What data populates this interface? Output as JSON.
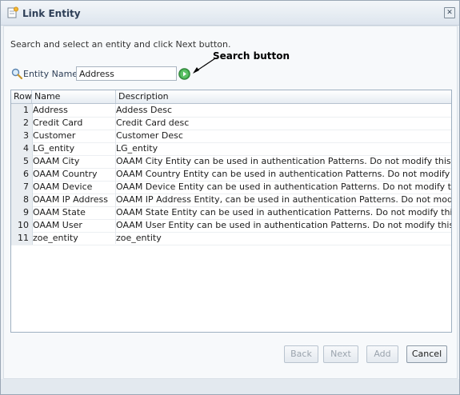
{
  "dialog": {
    "title": "Link Entity",
    "close_label": "✕",
    "instruction": "Search and select an entity and click Next button.",
    "entity_label": "Entity Name",
    "entity_value": "Address",
    "annotation": "Search button"
  },
  "table": {
    "columns": [
      "Row",
      "Name",
      "Description"
    ],
    "rows": [
      {
        "row": "1",
        "name": "Address",
        "description": "Addess Desc"
      },
      {
        "row": "2",
        "name": "Credit Card",
        "description": "Credit Card desc"
      },
      {
        "row": "3",
        "name": "Customer",
        "description": "Customer Desc"
      },
      {
        "row": "4",
        "name": "LG_entity",
        "description": "LG_entity"
      },
      {
        "row": "5",
        "name": "OAAM City",
        "description": "OAAM City Entity can be used in authentication Patterns. Do not modify this record."
      },
      {
        "row": "6",
        "name": "OAAM Country",
        "description": "OAAM Country Entity can be used in authentication Patterns. Do not modify this record."
      },
      {
        "row": "7",
        "name": "OAAM Device",
        "description": "OAAM Device Entity can be used in authentication Patterns. Do not modify this record."
      },
      {
        "row": "8",
        "name": "OAAM IP Address",
        "description": "OAAM IP Address Entity, can be used in authentication Patterns. Do not modify this record."
      },
      {
        "row": "9",
        "name": "OAAM State",
        "description": "OAAM State Entity can be used in authentication Patterns. Do not modify this record."
      },
      {
        "row": "10",
        "name": "OAAM User",
        "description": "OAAM User Entity can be used in authentication Patterns. Do not modify this record."
      },
      {
        "row": "11",
        "name": "zoe_entity",
        "description": "zoe_entity"
      }
    ]
  },
  "buttons": {
    "back": "Back",
    "next": "Next",
    "add": "Add",
    "cancel": "Cancel"
  },
  "colors": {
    "accent": "#2e3f57",
    "go_button": "#3fa64a",
    "disabled_text": "#9aa3ad"
  }
}
